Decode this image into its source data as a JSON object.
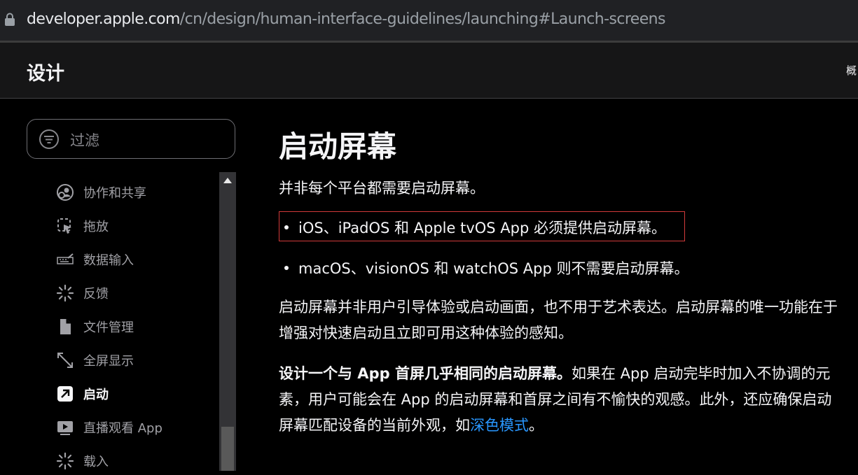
{
  "browser": {
    "url_host": "developer.apple.com",
    "url_path": "/cn/design/human-interface-guidelines/launching#Launch-screens"
  },
  "header": {
    "title": "设计",
    "nav_overview": "概"
  },
  "sidebar": {
    "filter_placeholder": "过滤",
    "items": [
      {
        "label": "协作和共享",
        "icon": "collaboration-icon",
        "active": false
      },
      {
        "label": "拖放",
        "icon": "drag-drop-icon",
        "active": false
      },
      {
        "label": "数据输入",
        "icon": "keyboard-icon",
        "active": false
      },
      {
        "label": "反馈",
        "icon": "spinner-icon",
        "active": false
      },
      {
        "label": "文件管理",
        "icon": "document-icon",
        "active": false
      },
      {
        "label": "全屏显示",
        "icon": "fullscreen-arrows-icon",
        "active": false
      },
      {
        "label": "启动",
        "icon": "launch-arrow-icon",
        "active": true
      },
      {
        "label": "直播观看 App",
        "icon": "play-icon",
        "active": false
      },
      {
        "label": "载入",
        "icon": "loading-spinner-icon",
        "active": false
      }
    ]
  },
  "content": {
    "heading": "启动屏幕",
    "intro": "并非每个平台都需要启动屏幕。",
    "bullets": [
      "iOS、iPadOS 和 Apple tvOS App 必须提供启动屏幕。",
      "macOS、visionOS 和 watchOS App 则不需要启动屏幕。"
    ],
    "para2": "启动屏幕并非用户引导体验或启动画面，也不用于艺术表达。启动屏幕的唯一功能在于增强对快速启动且立即可用这种体验的感知。",
    "para3_strong": "设计一个与 App 首屏几乎相同的启动屏幕。",
    "para3_text": "如果在 App 启动完毕时加入不协调的元素，用户可能会在 App 的启动屏幕和首屏之间有不愉快的观感。此外，还应确保启动屏幕匹配设备的当前外观，如",
    "para3_link": "深色模式",
    "para3_end": "。"
  },
  "colors": {
    "background": "#000000",
    "link": "#2997ff",
    "highlight_border": "#d23a3a",
    "text": "#f5f5f7",
    "muted": "#a1a1a6"
  }
}
